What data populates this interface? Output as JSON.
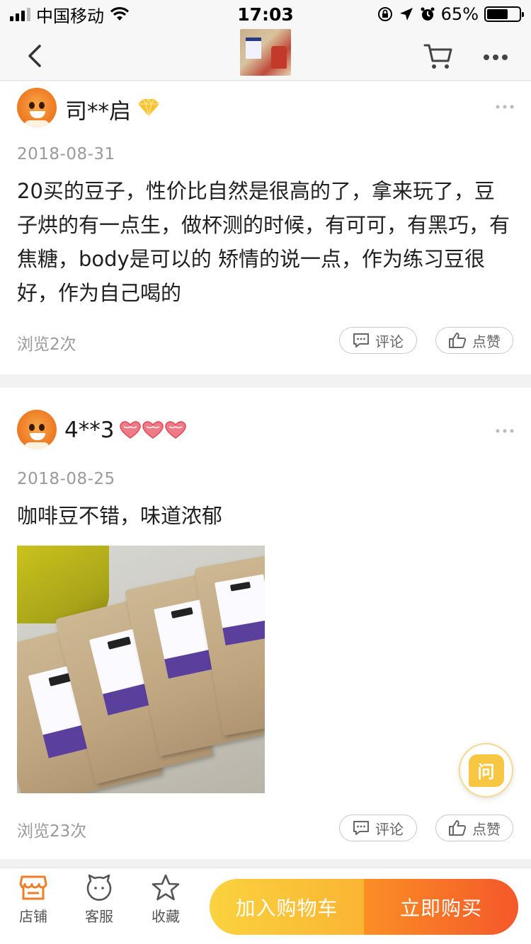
{
  "status_bar": {
    "carrier": "中国移动",
    "time": "17:03",
    "battery_percent": "65%",
    "battery_level": 0.65,
    "icons": [
      "signal-icon",
      "wifi-icon",
      "orientation-lock-icon",
      "location-icon",
      "alarm-icon",
      "battery-icon"
    ]
  },
  "nav": {
    "icons": [
      "back-icon",
      "product-thumbnail",
      "cart-icon",
      "more-icon"
    ]
  },
  "reviews": [
    {
      "username": "司**启",
      "badge": "diamond-badge-icon",
      "date": "2018-08-31",
      "text": "20买的豆子，性价比自然是很高的了，拿来玩了，豆子烘的有一点生，做杯测的时候，有可可，有黑巧，有焦糖，body是可以的 矫情的说一点，作为练习豆很好，作为自己喝的",
      "views": "浏览2次",
      "comment_label": "评论",
      "like_label": "点赞"
    },
    {
      "username": "4**3",
      "badge": "heart-badge-icon",
      "badge_count": 3,
      "date": "2018-08-25",
      "text": "咖啡豆不错，味道浓郁",
      "photo": "coffee-bags-photo",
      "views": "浏览23次",
      "comment_label": "评论",
      "like_label": "点赞"
    }
  ],
  "ask_button": {
    "label": "问"
  },
  "bottom_bar": {
    "tabs": [
      {
        "label": "店铺",
        "icon": "store-icon"
      },
      {
        "label": "客服",
        "icon": "customer-service-icon"
      },
      {
        "label": "收藏",
        "icon": "star-icon"
      }
    ],
    "add_to_cart": "加入购物车",
    "buy_now": "立即购买"
  },
  "colors": {
    "accent_orange": "#f4582a",
    "accent_yellow": "#fbd23f",
    "store_icon": "#ef7d26",
    "text_gray": "#9a9a9a"
  }
}
